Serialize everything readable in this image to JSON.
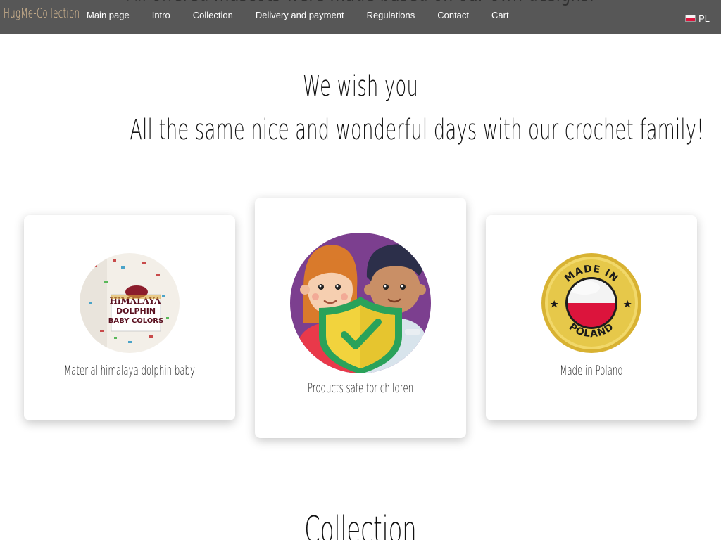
{
  "brand": "HugMe-Collection",
  "background_heading": "All offered mascots were made based on our own designs.",
  "nav": {
    "items": [
      {
        "label": "Main page"
      },
      {
        "label": "Intro"
      },
      {
        "label": "Collection"
      },
      {
        "label": "Delivery and payment"
      },
      {
        "label": "Regulations"
      },
      {
        "label": "Contact"
      },
      {
        "label": "Cart"
      }
    ],
    "language": "PL"
  },
  "hero": {
    "line1": "We wish you",
    "line2": "All the same nice and wonderful days with our crochet family!"
  },
  "features": [
    {
      "label": "Material himalaya dolphin baby",
      "icon": "yarn-label-icon",
      "badge_text": [
        "HiMALAYA",
        "DOLPHIN",
        "BABY COLORS"
      ]
    },
    {
      "label": "Products safe for children",
      "icon": "child-safety-shield-icon"
    },
    {
      "label": "Made in Poland",
      "icon": "made-in-poland-badge-icon",
      "badge_text": [
        "MADE IN",
        "POLAND"
      ]
    }
  ],
  "section": {
    "title": "Collection"
  },
  "colors": {
    "navbar": "#575757",
    "brand": "#e8c79a",
    "shield": "#f2d33d",
    "check": "#3cae5c",
    "circle_purple": "#7c3f8f",
    "badge_gold": "#d8b232",
    "poland_red": "#dc143c"
  }
}
